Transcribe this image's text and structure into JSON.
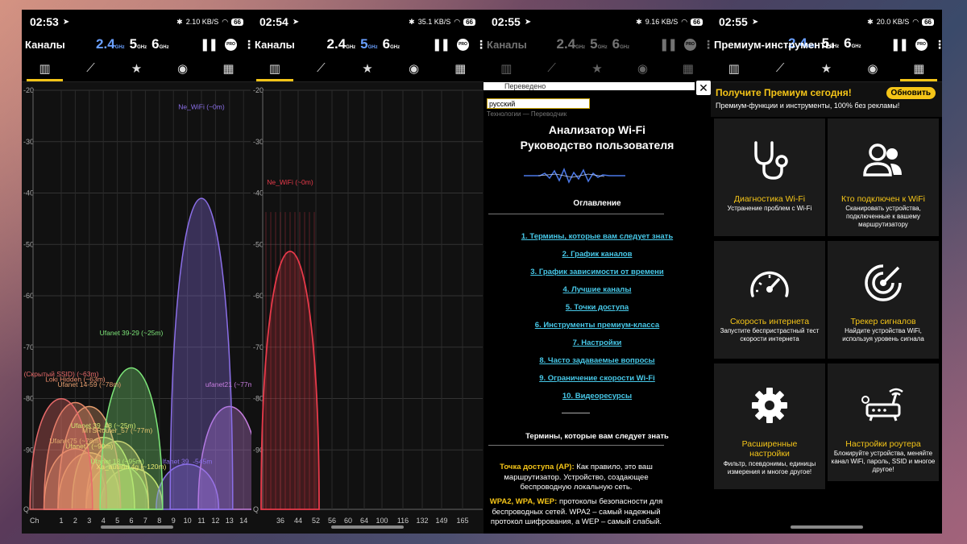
{
  "screens": [
    {
      "time": "02:53",
      "net_speed": "2.10 KB/S",
      "battery": "66",
      "title": "Каналы",
      "bands": [
        "2.4",
        "5",
        "6"
      ],
      "band_unit": "GHz",
      "selected_band": "2.4",
      "pro": "PRO",
      "y_ticks": [
        "-20",
        "-30",
        "-40",
        "-50",
        "-60",
        "-70",
        "-80",
        "-90",
        "Q"
      ],
      "x_label": "Ch",
      "x_ticks": [
        "1",
        "2",
        "3",
        "4",
        "5",
        "6",
        "7",
        "8",
        "9",
        "10",
        "11",
        "12",
        "13",
        "14"
      ],
      "networks": [
        {
          "label": "Ne_WiFi (~0m)",
          "channel": 11,
          "rssi": -24,
          "color": "#8b6fe8"
        },
        {
          "label": "Ufanet 39-29 (~25m)",
          "channel": 6,
          "rssi": -68,
          "color": "#7ee87a"
        },
        {
          "label": "ufanet21 (~77m",
          "channel": 13,
          "rssi": -78,
          "color": "#c77ee0"
        },
        {
          "label": "(Скрытый SSID) (~63m)",
          "channel": 1,
          "rssi": -76,
          "color": "#e86a6a"
        },
        {
          "label": "Loki Hidden (~63m)",
          "channel": 2,
          "rssi": -77,
          "color": "#e88a6a"
        },
        {
          "label": "Ufanet 14-59 (~78m)",
          "channel": 3,
          "rssi": -78,
          "color": "#e8a070"
        },
        {
          "label": "Ufanet 39_48 (~25m)",
          "channel": 4,
          "rssi": -86,
          "color": "#d0e870"
        },
        {
          "label": "MTSRouter_57 (~77m)",
          "channel": 5,
          "rssi": -87,
          "color": "#e8c870"
        },
        {
          "label": "Ufanet75 (~78m)",
          "channel": 2,
          "rssi": -89,
          "color": "#e8b070"
        },
        {
          "label": "Ufanet7 (~90m)",
          "channel": 3,
          "rssi": -90,
          "color": "#e8d870"
        },
        {
          "label": "Ufanet 18 (~95m)",
          "channel": 5,
          "rssi": -93,
          "color": "#b0e870"
        },
        {
          "label": "Xa_autatin 4g (~120m)",
          "channel": 6,
          "rssi": -94,
          "color": "#e8e870"
        },
        {
          "label": "lfanet 39_-545m",
          "channel": 10,
          "rssi": -93,
          "color": "#8b6fe8"
        }
      ]
    },
    {
      "time": "02:54",
      "net_speed": "35.1 KB/S",
      "battery": "66",
      "title": "Каналы",
      "bands": [
        "2.4",
        "5",
        "6"
      ],
      "band_unit": "GHz",
      "selected_band": "5",
      "pro": "PRO",
      "y_ticks": [
        "-20",
        "-30",
        "-40",
        "-50",
        "-60",
        "-70",
        "-80",
        "-90",
        "Q"
      ],
      "x_ticks": [
        "36",
        "44",
        "52",
        "56",
        "60",
        "64",
        "100",
        "116",
        "132",
        "149",
        "165"
      ],
      "networks": [
        {
          "label": "Ne_WiFi (~0m)",
          "channel": 44,
          "rssi": -39,
          "color": "#e83a4a"
        }
      ]
    },
    {
      "time": "02:55",
      "net_speed": "9.16 KB/S",
      "battery": "66",
      "title": "Каналы",
      "bands": [
        "2.4",
        "5",
        "6"
      ],
      "band_unit": "GHz",
      "pro": "PRO",
      "translated": "Переведено",
      "language": "русский",
      "translate_credit": "Технологии — Переводчик",
      "guide_title_1": "Анализатор Wi-Fi",
      "guide_title_2": "Руководство пользователя",
      "toc_heading": "Оглавление",
      "toc": [
        "1. Термины, которые вам следует знать",
        "2. График каналов",
        "3. График зависимости от времени",
        "4. Лучшие каналы",
        "5. Точки доступа",
        "6. Инструменты премиум-класса",
        "7. Настройки",
        "8. Часто задаваемые вопросы",
        "9. Ограничение скорости Wi-Fi",
        "10. Видеоресурсы"
      ],
      "section_heading": "Термины, которые вам следует знать",
      "term1_name": "Точка доступа (AP):",
      "term1_text": "Как правило, это ваш маршрутизатор. Устройство, создающее беспроводную локальную сеть.",
      "term2_name": "WPA2, WPA, WEP:",
      "term2_text": "протоколы безопасности для беспроводных сетей. WPA2 – самый надежный протокол шифрования, а WEP – самый слабый."
    },
    {
      "time": "02:55",
      "net_speed": "20.0 KB/S",
      "battery": "66",
      "title": "Премиум-инструменты",
      "bands": [
        "2.4",
        "5",
        "6"
      ],
      "band_unit": "GHz",
      "pro": "PRO",
      "promo_head": "Получите Премиум сегодня!",
      "promo_sub": "Премиум-функции и инструменты, 100% без рекламы!",
      "promo_button": "Обновить",
      "tools": [
        {
          "icon": "stethoscope-icon",
          "name": "Диагностика Wi-Fi",
          "desc": "Устранение проблем с Wi-Fi"
        },
        {
          "icon": "users-icon",
          "name": "Кто подключен к WiFi",
          "desc": "Сканировать устройства, подключенные к вашему маршрутизатору"
        },
        {
          "icon": "speedometer-icon",
          "name": "Скорость интернета",
          "desc": "Запустите беспристрастный тест скорости интернета"
        },
        {
          "icon": "signal-tracker-icon",
          "name": "Трекер сигналов",
          "desc": "Найдите устройства WiFi, используя уровень сигнала"
        },
        {
          "icon": "gear-icon",
          "name": "Расширенные настройки",
          "desc": "Фильтр, псевдонимы, единицы измерения и многое другое!"
        },
        {
          "icon": "router-icon",
          "name": "Настройки роутера",
          "desc": "Блокируйте устройства, меняйте канал WiFi, пароль, SSID и многое другое!"
        }
      ]
    }
  ]
}
